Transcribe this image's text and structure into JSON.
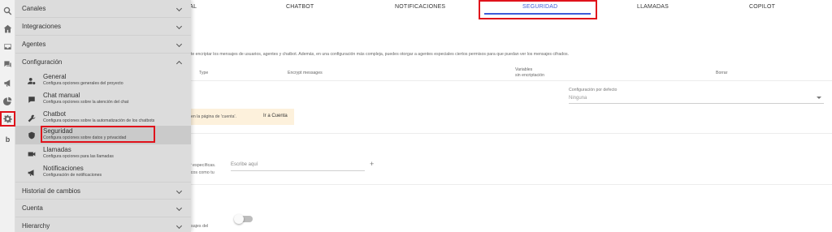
{
  "tabs": [
    {
      "label": "UAL",
      "selected": false
    },
    {
      "label": "CHATBOT",
      "selected": false
    },
    {
      "label": "NOTIFICACIONES",
      "selected": false
    },
    {
      "label": "SEGURIDAD",
      "selected": true
    },
    {
      "label": "LLAMADAS",
      "selected": false
    },
    {
      "label": "COPILOT",
      "selected": false
    }
  ],
  "content": {
    "description": "nte encriptar los mensajes de usuarios, agentes y chatbot. Además, en una configuración más compleja, puedes otorgar a agentes especiales ciertos permisos para que puedan ver los mensajes cifrados.",
    "table": {
      "type": "Type",
      "encrypt": "Encrypt messages",
      "variables_line1": "Variables",
      "variables_line2": "sin encriptación",
      "borrar": "Borrar"
    },
    "config_label": "Configuración por defecto",
    "config_value": "Ninguna",
    "notice_text": "en la página de 'cuenta'.",
    "notice_button": "Ir a Cuenta",
    "ip_text_1": "P específicas.",
    "ip_text_2": "ficos como tu",
    "ip_placeholder": "Escribe aquí",
    "plus": "+",
    "messages_text": "nsajes del"
  },
  "rail": {
    "b_label": "b",
    "icons": [
      "search-icon",
      "home-icon",
      "inbox-icon",
      "chat-icon",
      "megaphone-icon",
      "pie-chart-icon",
      "gear-icon"
    ]
  },
  "menu": {
    "sections_top": [
      {
        "label": "Canales"
      },
      {
        "label": "Integraciones"
      },
      {
        "label": "Agentes"
      },
      {
        "label": "Configuración"
      }
    ],
    "items": [
      {
        "title": "General",
        "desc": "Configura opciones generales del proyecto",
        "icon": "user-gear-icon"
      },
      {
        "title": "Chat manual",
        "desc": "Configura opciones sobre la atención del chat",
        "icon": "chat-bubble-icon"
      },
      {
        "title": "Chatbot",
        "desc": "Configura opciones sobre la automatización de los chatbots",
        "icon": "wrench-icon"
      },
      {
        "title": "Seguridad",
        "desc": "Configura opciones sobre datos y privacidad",
        "icon": "shield-icon"
      },
      {
        "title": "Llamadas",
        "desc": "Configura opciones para las llamadas",
        "icon": "video-camera-icon"
      },
      {
        "title": "Notificaciones",
        "desc": "Configuración de notificaciones",
        "icon": "megaphone-icon"
      }
    ],
    "sections_bottom": [
      {
        "label": "Historial de cambios"
      },
      {
        "label": "Cuenta"
      },
      {
        "label": "Hierarchy"
      }
    ]
  },
  "colors": {
    "accent": "#3d5bd9",
    "highlight": "#e0121b",
    "menu_bg": "#dcdcdc",
    "notice_bg": "#fdf1dc"
  }
}
